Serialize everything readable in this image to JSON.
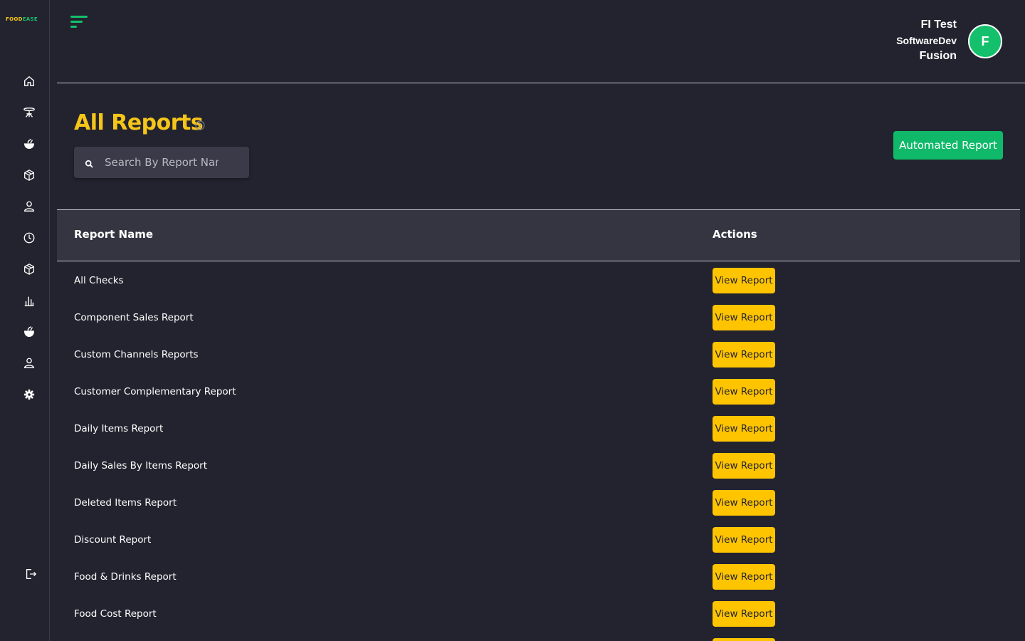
{
  "brand": {
    "logo_food": "FOOD",
    "logo_ease": "EASE"
  },
  "user": {
    "line1": "FI Test",
    "line2": "SoftwareDev",
    "line3": "Fusion",
    "avatar_initial": "F"
  },
  "page": {
    "title": "All Reports",
    "search_placeholder": "Search By Report Name",
    "automated_button": "Automated Report"
  },
  "table": {
    "headers": {
      "name": "Report Name",
      "actions": "Actions"
    },
    "action_label": "View Report",
    "rows": [
      {
        "name": "All Checks"
      },
      {
        "name": "Component Sales Report"
      },
      {
        "name": "Custom Channels Reports"
      },
      {
        "name": "Customer Complementary Report"
      },
      {
        "name": "Daily Items Report"
      },
      {
        "name": "Daily Sales By Items Report"
      },
      {
        "name": "Deleted Items Report"
      },
      {
        "name": "Discount Report"
      },
      {
        "name": "Food & Drinks Report"
      },
      {
        "name": "Food Cost Report"
      },
      {
        "name": ""
      }
    ]
  },
  "sidebar": {
    "items": [
      {
        "icon": "home-icon"
      },
      {
        "icon": "table-icon"
      },
      {
        "icon": "food-icon"
      },
      {
        "icon": "box-icon"
      },
      {
        "icon": "user-icon"
      },
      {
        "icon": "clock-icon"
      },
      {
        "icon": "package-icon"
      },
      {
        "icon": "bar-chart-icon"
      },
      {
        "icon": "food-filled-icon"
      },
      {
        "icon": "person-icon"
      },
      {
        "icon": "settings-icon"
      }
    ],
    "logout_icon": "logout-icon"
  },
  "colors": {
    "background": "#23232f",
    "accent_yellow": "#f5c518",
    "accent_green": "#10b96a",
    "button_yellow": "#ffc400"
  }
}
